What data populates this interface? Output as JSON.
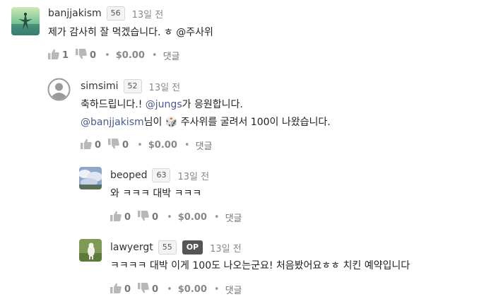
{
  "comments": [
    {
      "author": "banjjakism",
      "reputation": "56",
      "time": "13일 전",
      "op": "",
      "body_line1": "제가 감사히 잘 먹겠습니다. ㅎ @주사위",
      "upvotes": "1",
      "downvotes": "0",
      "payout": "$0.00",
      "reply_label": "댓글"
    },
    {
      "author": "simsimi",
      "reputation": "52",
      "time": "13일 전",
      "op": "",
      "line1_a": "축하드립니다.! ",
      "line1_mention": "@jungs",
      "line1_b": "가 응원합니다.",
      "line2_mention": "@banjjakism",
      "line2_a": "님이 ",
      "line2_emoji": "🎲",
      "line2_b": " 주사위를 굴려서 100이 나왔습니다.",
      "upvotes": "0",
      "downvotes": "0",
      "payout": "$0.00",
      "reply_label": "댓글"
    },
    {
      "author": "beoped",
      "reputation": "63",
      "time": "13일 전",
      "op": "",
      "body_line1": "와 ㅋㅋㅋ 대박 ㅋㅋㅋ",
      "upvotes": "0",
      "downvotes": "0",
      "payout": "$0.00",
      "reply_label": "댓글"
    },
    {
      "author": "lawyergt",
      "reputation": "55",
      "time": "13일 전",
      "op": "OP",
      "body_line1": "ㅋㅋㅋㅋ 대박 이게 100도 나오는군요! 처음봤어요ㅎㅎ 치킨 예약입니다",
      "upvotes": "0",
      "downvotes": "0",
      "payout": "$0.00",
      "reply_label": "댓글"
    }
  ],
  "icons": {
    "upvote": "thumbs-up-icon",
    "downvote": "thumbs-down-icon",
    "default_avatar": "user-silhouette-icon"
  },
  "colors": {
    "mention": "#4a5a8f",
    "icon_gray": "#b8b8b8",
    "op_badge": "#555555"
  }
}
